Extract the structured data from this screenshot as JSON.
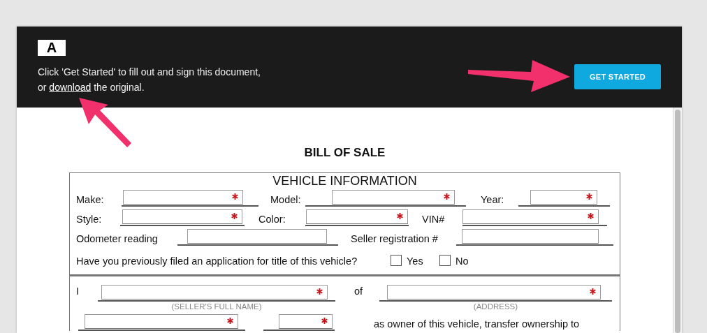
{
  "banner": {
    "logo": "A",
    "line1": "Click 'Get Started' to fill out and sign this document,",
    "line2_before": "or",
    "link": "download",
    "line2_after": "the original.",
    "button": "GET STARTED"
  },
  "document": {
    "title": "BILL OF SALE",
    "section": "VEHICLE INFORMATION",
    "lines": [
      {
        "items": [
          {
            "kind": "label",
            "text": "Make:"
          },
          {
            "kind": "field",
            "required": true
          },
          {
            "kind": "label",
            "text": "Model:"
          },
          {
            "kind": "field",
            "required": true
          },
          {
            "kind": "label",
            "text": "Year:"
          },
          {
            "kind": "field",
            "required": true
          }
        ]
      },
      {
        "items": [
          {
            "kind": "label",
            "text": "Style:"
          },
          {
            "kind": "field",
            "required": true
          },
          {
            "kind": "label",
            "text": "Color:"
          },
          {
            "kind": "field",
            "required": true
          },
          {
            "kind": "label",
            "text": "VIN#"
          },
          {
            "kind": "field",
            "required": true
          }
        ]
      },
      {
        "items": [
          {
            "kind": "label",
            "text": "Odometer reading"
          },
          {
            "kind": "field",
            "required": false
          },
          {
            "kind": "label",
            "text": "Seller registration #"
          },
          {
            "kind": "field",
            "required": false
          }
        ]
      },
      {
        "items": [
          {
            "kind": "label",
            "text": "Have you previously filed an application for title of this vehicle?"
          },
          {
            "kind": "checkbox",
            "text": "Yes",
            "checked": false
          },
          {
            "kind": "checkbox",
            "text": "No",
            "checked": false
          }
        ]
      }
    ],
    "lines_after_divider": [
      {
        "items": [
          {
            "kind": "label",
            "text": "I"
          },
          {
            "kind": "field",
            "required": true,
            "caption": "(SELLER'S FULL NAME)"
          },
          {
            "kind": "label",
            "text": "of"
          },
          {
            "kind": "field",
            "required": true,
            "caption": "(ADDRESS)"
          }
        ]
      },
      {
        "items": [
          {
            "kind": "field",
            "required": true
          },
          {
            "kind": "field",
            "required": true
          },
          {
            "kind": "label",
            "text": "as owner of this vehicle, transfer ownership to"
          }
        ]
      }
    ]
  }
}
